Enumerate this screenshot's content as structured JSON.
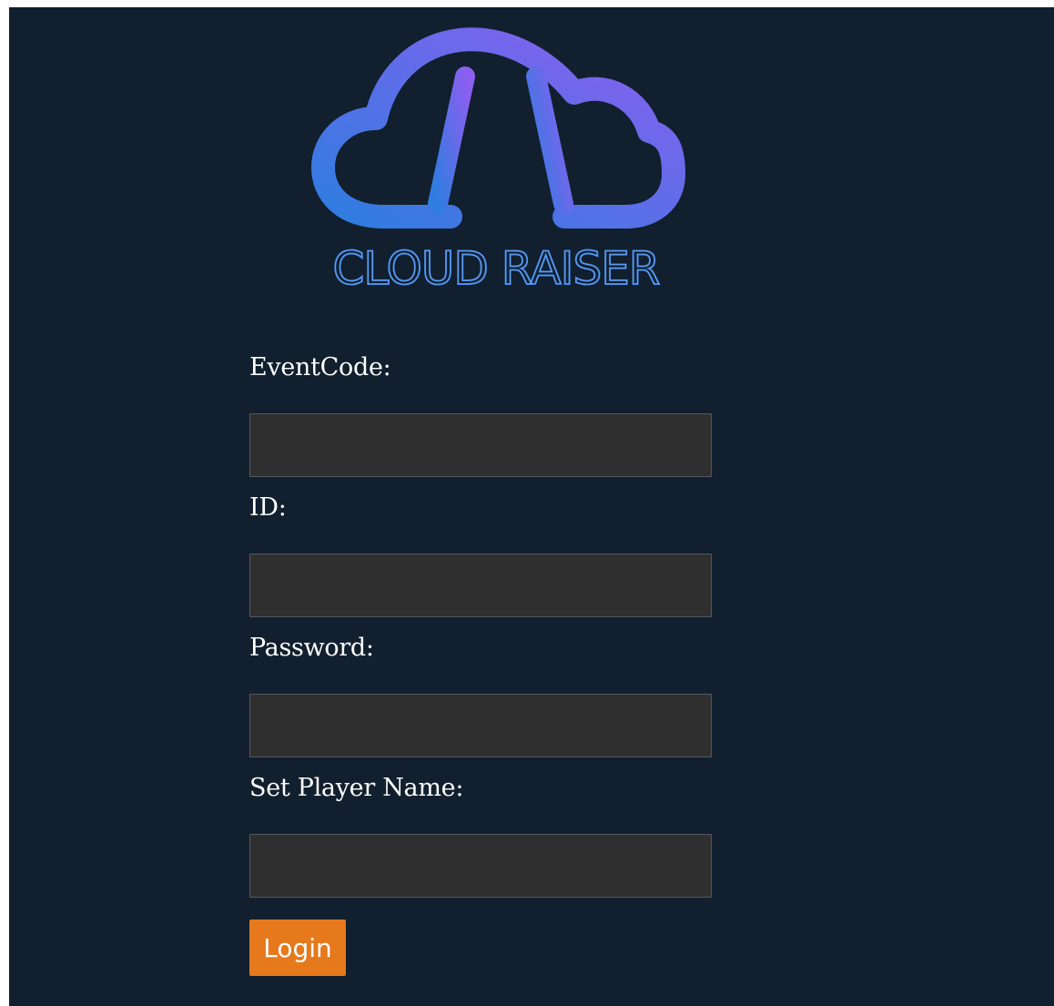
{
  "logo": {
    "brand_text": "CLOUD RAISER",
    "icon": "cloud-ladder-icon",
    "gradient_start": "#2f7de0",
    "gradient_end": "#8b5ff0"
  },
  "form": {
    "fields": [
      {
        "label": "EventCode:",
        "value": ""
      },
      {
        "label": "ID:",
        "value": ""
      },
      {
        "label": "Password:",
        "value": ""
      },
      {
        "label": "Set Player Name:",
        "value": ""
      }
    ],
    "login_label": "Login"
  },
  "colors": {
    "background": "#111f2e",
    "input_background": "#2f2f2f",
    "button": "#e6791b",
    "text": "#ffffff"
  }
}
